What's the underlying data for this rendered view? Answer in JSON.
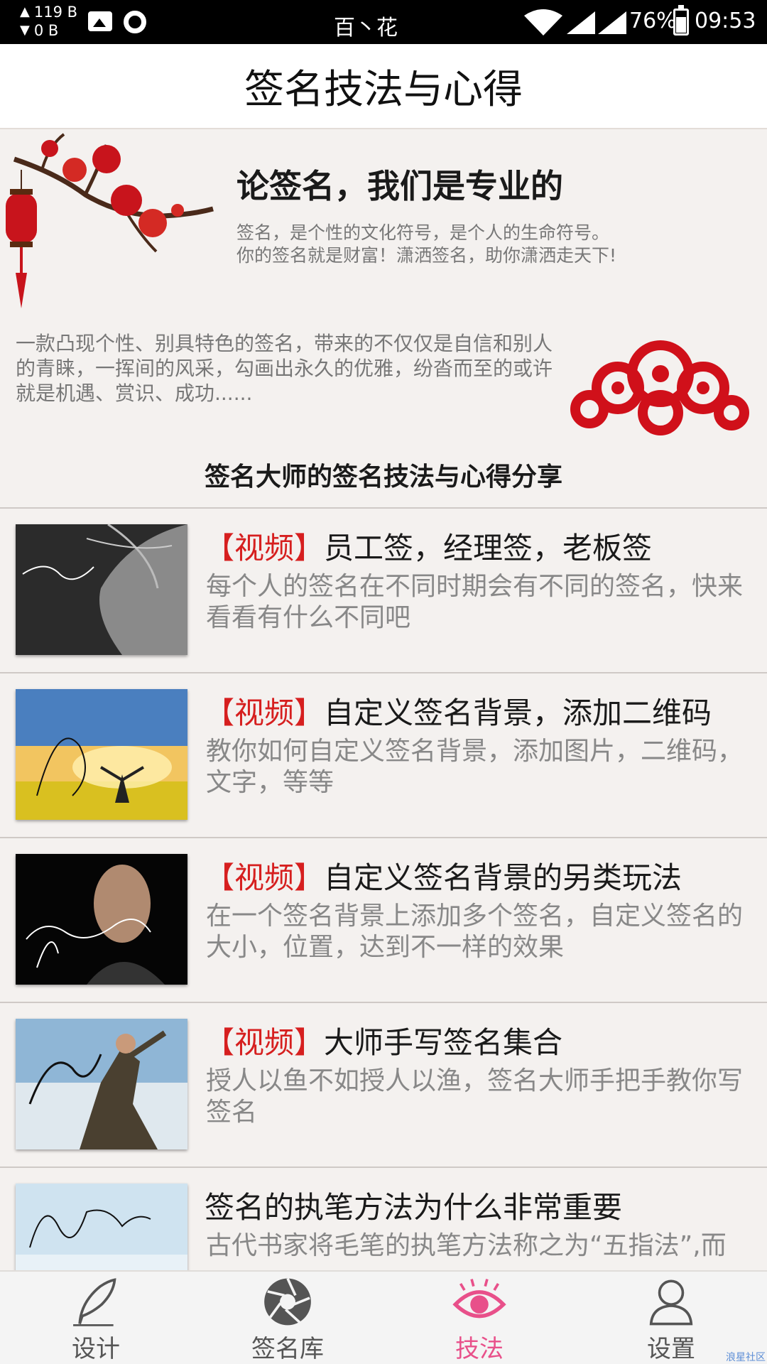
{
  "status_bar": {
    "net_up": "119 B",
    "net_down": "0 B",
    "carrier": "百丶花",
    "battery": "76%",
    "time": "09:53",
    "icons": [
      "image-icon",
      "circle-icon",
      "wifi-icon",
      "signal-icon",
      "battery-icon"
    ]
  },
  "header": {
    "title": "签名技法与心得"
  },
  "banner": {
    "title": "论签名，我们是专业的",
    "subtitle_line1": "签名，是个性的文化符号，是个人的生命符号。",
    "subtitle_line2": "你的签名就是财富！潇洒签名，助你潇洒走天下!",
    "body": "一款凸现个性、别具特色的签名，带来的不仅仅是自信和别人的青睐，一挥间的风采，勾画出永久的优雅，纷沓而至的或许就是机遇、赏识、成功......",
    "section_heading": "签名大师的签名技法与心得分享"
  },
  "articles": [
    {
      "tag": "【视频】",
      "title": "员工签，经理签，老板签",
      "desc": "每个人的签名在不同时期会有不同的签名，快来看看有什么不同吧"
    },
    {
      "tag": "【视频】",
      "title": "自定义签名背景，添加二维码",
      "desc": "教你如何自定义签名背景，添加图片，二维码，文字，等等"
    },
    {
      "tag": "【视频】",
      "title": "自定义签名背景的另类玩法",
      "desc": "在一个签名背景上添加多个签名，自定义签名的大小，位置，达到不一样的效果"
    },
    {
      "tag": "【视频】",
      "title": "大师手写签名集合",
      "desc": "授人以鱼不如授人以渔，签名大师手把手教你写签名"
    },
    {
      "tag": "",
      "title": "签名的执笔方法为什么非常重要",
      "desc": "古代书家将毛笔的执笔方法称之为“五指法”,而"
    }
  ],
  "bottom_nav": [
    {
      "label": "设计",
      "icon": "quill-pen-icon",
      "active": false
    },
    {
      "label": "签名库",
      "icon": "aperture-icon",
      "active": false
    },
    {
      "label": "技法",
      "icon": "eye-icon",
      "active": true
    },
    {
      "label": "设置",
      "icon": "user-icon",
      "active": false
    }
  ],
  "colors": {
    "accent": "#e8508a",
    "tag_red": "#d61f1f",
    "background": "#f4f1ef"
  },
  "watermark": "浪星社区"
}
